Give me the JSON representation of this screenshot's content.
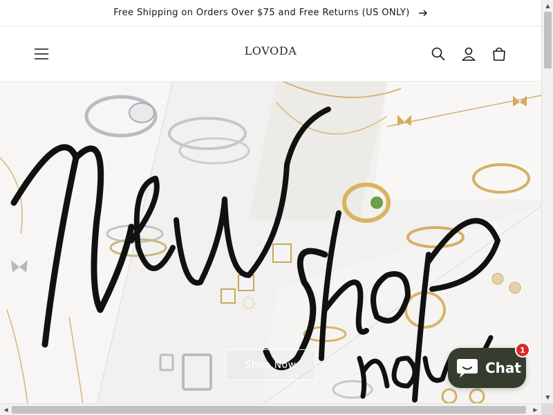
{
  "announcement": {
    "text": "Free Shipping on Orders Over $75 and Free Returns (US ONLY)",
    "arrow_icon": "arrow-right-icon"
  },
  "header": {
    "logo_text": "LOVODA",
    "icons": {
      "menu": "hamburger-menu-icon",
      "search": "search-icon",
      "account": "user-icon",
      "cart": "cart-icon"
    }
  },
  "hero": {
    "cta_label": "Shop Now"
  },
  "chat": {
    "label": "Chat",
    "badge_count": "1",
    "icon": "chat-bubble-icon"
  },
  "colors": {
    "chat_bg": "#363d2f",
    "badge_bg": "#d72c2c",
    "text": "#121212"
  }
}
